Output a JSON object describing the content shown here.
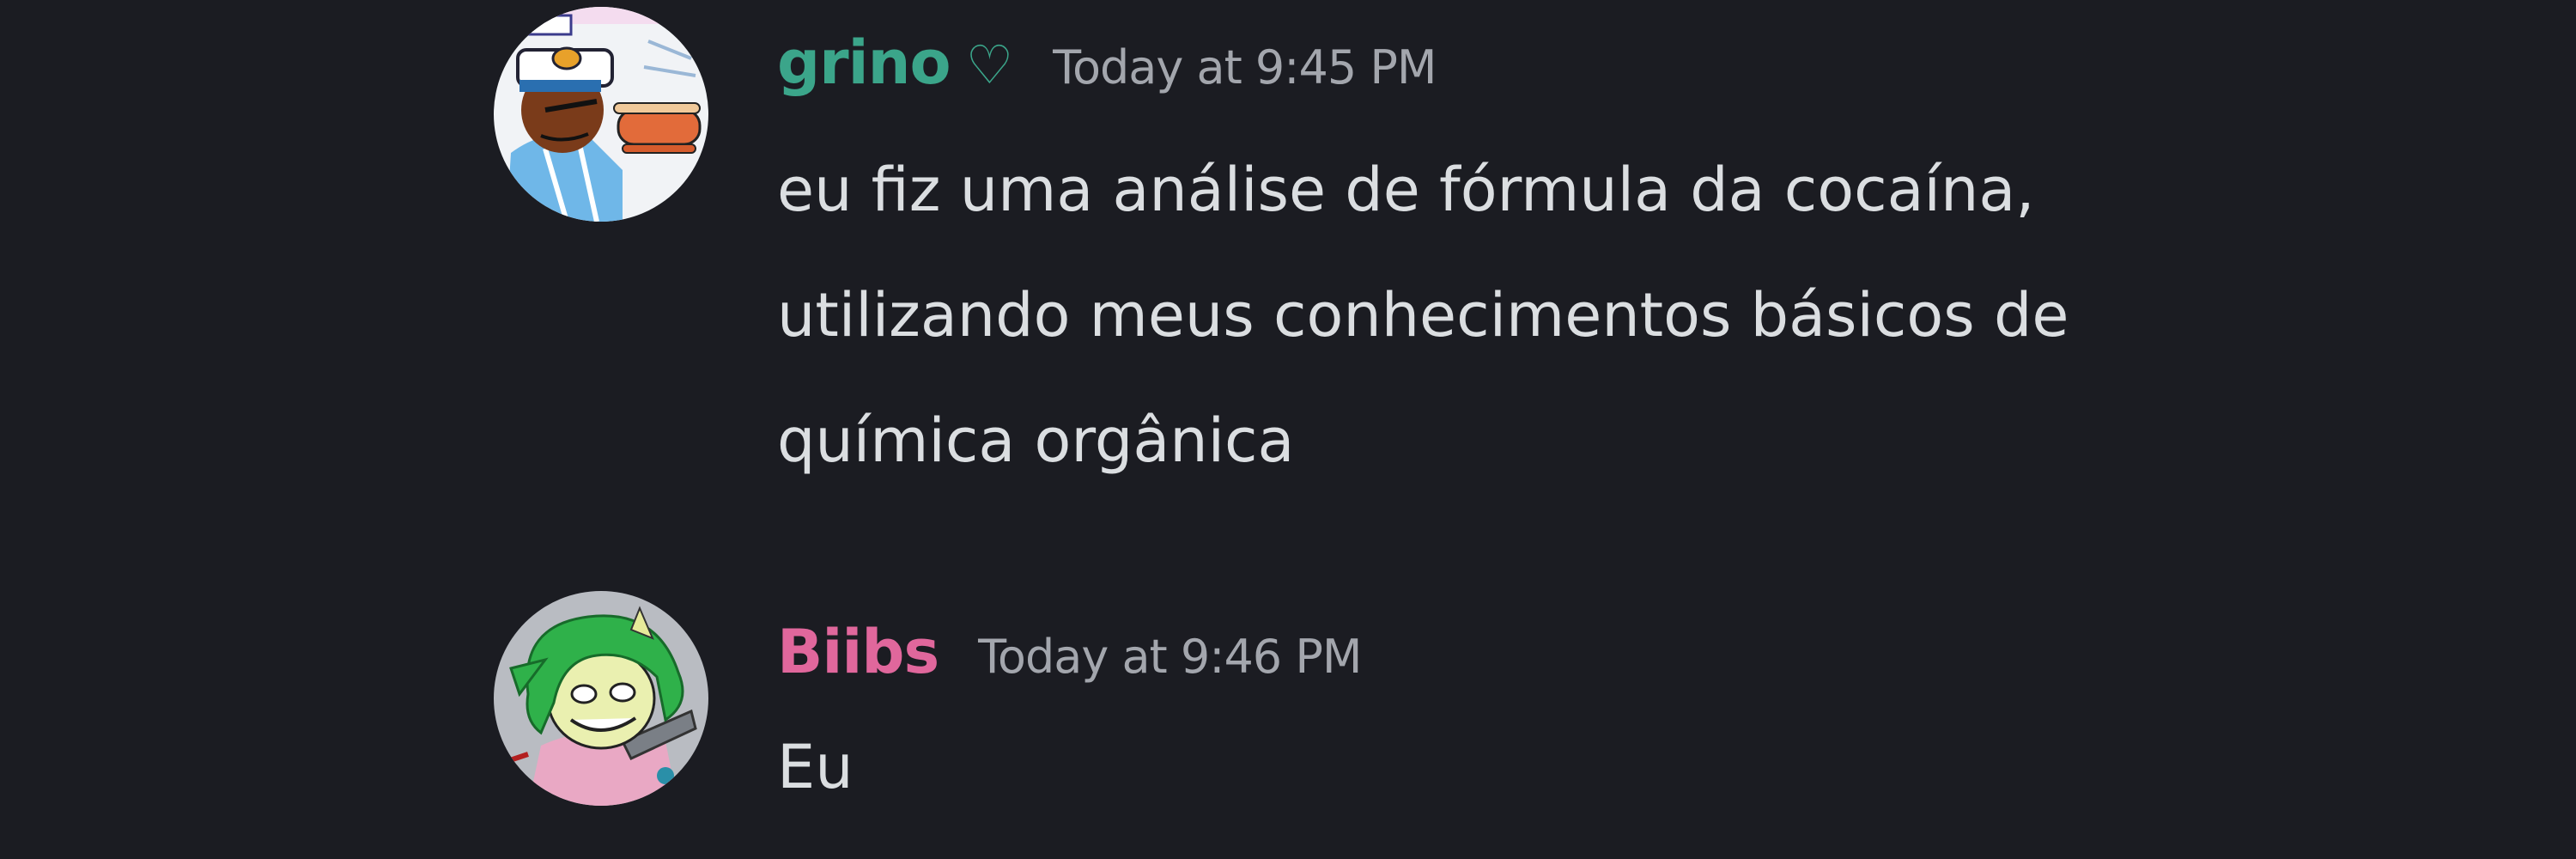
{
  "messages": [
    {
      "username": "grino",
      "username_color": "#3ba58a",
      "badge": "♡",
      "timestamp": "Today at 9:45 PM",
      "lines": [
        "eu fiz uma análise de fórmula da cocaína,",
        "utilizando meus conhecimentos básicos de",
        "química orgânica"
      ],
      "avatar_icon": "user-avatar"
    },
    {
      "username": "Biibs",
      "username_color": "#e0679c",
      "timestamp": "Today at 9:46 PM",
      "lines": [
        "Eu"
      ],
      "avatar_icon": "user-avatar"
    }
  ],
  "colors": {
    "background": "#1b1c22",
    "message_text": "#dbdee1",
    "timestamp_text": "#a3a6ad"
  }
}
